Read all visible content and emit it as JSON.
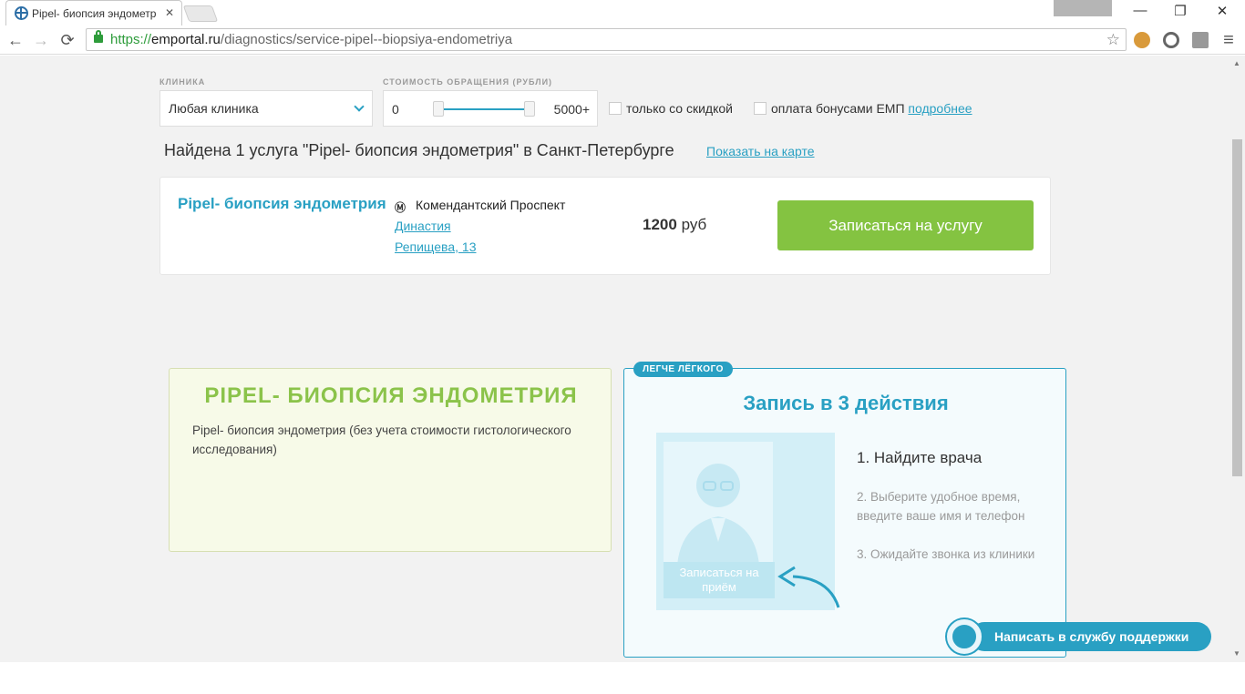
{
  "browser": {
    "tab_title": "Pipel- биопсия эндометр",
    "tab_close": "✕",
    "window_minimize": "—",
    "window_restore": "❐",
    "window_close": "✕",
    "url_scheme": "https://",
    "url_host": "emportal.ru",
    "url_path": "/diagnostics/service-pipel--biopsiya-endometriya",
    "back_icon": "←",
    "forward_icon": "→",
    "reload_icon": "⟳",
    "star_icon": "☆"
  },
  "filters": {
    "clinic_label": "КЛИНИКА",
    "clinic_value": "Любая клиника",
    "price_label": "СТОИМОСТЬ ОБРАЩЕНИЯ (РУБЛИ)",
    "price_min": "0",
    "price_max": "5000+",
    "discount_label": "только со скидкой",
    "bonus_label": "оплата бонусами ЕМП",
    "bonus_more_link": "подробнее"
  },
  "results": {
    "summary": "Найдена 1 услуга \"Pipel- биопсия эндометрия\" в Санкт-Петербурге",
    "map_link": "Показать на карте"
  },
  "service_card": {
    "name": "Pipel- биопсия эндометрия",
    "metro_icon": "Ⓜ",
    "metro": "Комендантский Проспект",
    "clinic": "Династия",
    "address": "Репищева, 13",
    "price_value": "1200",
    "price_currency": "руб",
    "book_button": "Записаться на услугу"
  },
  "description": {
    "title": "PIPEL- БИОПСИЯ ЭНДОМЕТРИЯ",
    "text": "Pipel- биопсия эндометрия (без учета стоимости гистологического исследования)"
  },
  "steps": {
    "badge": "ЛЕГЧЕ ЛЁГКОГО",
    "title": "Запись в 3 действия",
    "illustration_button": "Записаться на приём",
    "step1": "1. Найдите врача",
    "step2": "2. Выберите удобное время, введите ваше имя и телефон",
    "step3": "3. Ожидайте звонка из клиники"
  },
  "support": {
    "label": "Написать в службу поддержки"
  },
  "colors": {
    "accent": "#29a0c3",
    "book_button": "#84c341",
    "desc_title": "#8bc34a"
  }
}
